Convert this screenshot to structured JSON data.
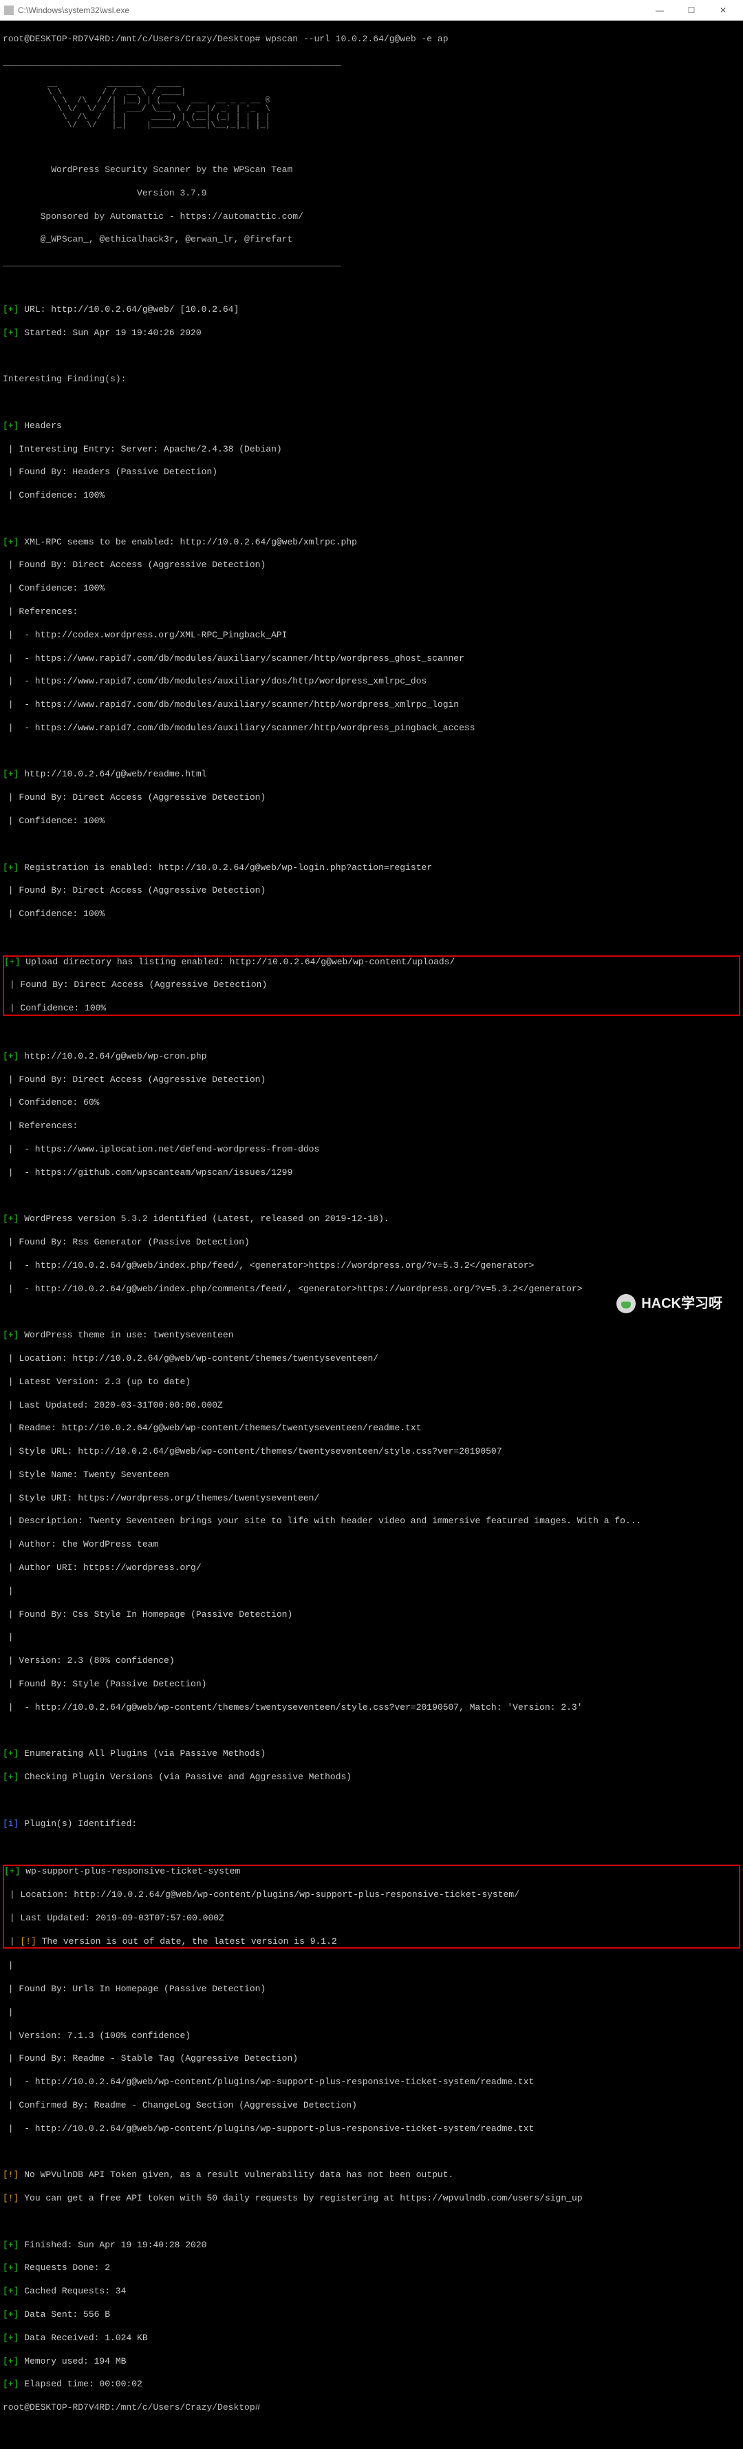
{
  "window": {
    "title": "C:\\Windows\\system32\\wsl.exe",
    "min": "—",
    "max": "☐",
    "close": "✕"
  },
  "prompt1": "root@DESKTOP-RD7V4RD:/mnt/c/Users/Crazy/Desktop# wpscan --url 10.0.2.64/g@web -e ap",
  "logo_art": "         __          _______   _____\n         \\ \\        / /  __ \\ / ____|\n          \\ \\  /\\  / /| |__) | (___   ___  __ _ _ __ ®\n           \\ \\/  \\/ / |  ___/ \\___ \\ / __|/ _` | '_  \\\n            \\  /\\  /  | |     ____) | (__| (_| | | | |\n             \\/  \\/   |_|    |_____/ \\___|\\__,_|_| |_|",
  "banner": {
    "l1": "         WordPress Security Scanner by the WPScan Team",
    "l2": "                         Version 3.7.9",
    "l3": "       Sponsored by Automattic - https://automattic.com/",
    "l4": "       @_WPScan_, @ethicalhack3r, @erwan_lr, @firefart"
  },
  "divtop": "_______________________________________________________________",
  "divbot": "_______________________________________________________________",
  "startinfo": {
    "url": "URL: http://10.0.2.64/g@web/ [10.0.2.64]",
    "started": "Started: Sun Apr 19 19:40:26 2020"
  },
  "heading_findings": "Interesting Finding(s):",
  "headers": {
    "title": "Headers",
    "l1": "Interesting Entry: Server: Apache/2.4.38 (Debian)",
    "l2": "Found By: Headers (Passive Detection)",
    "l3": "Confidence: 100%"
  },
  "xmlrpc": {
    "title": "XML-RPC seems to be enabled: http://10.0.2.64/g@web/xmlrpc.php",
    "l1": "Found By: Direct Access (Aggressive Detection)",
    "l2": "Confidence: 100%",
    "l3": "References:",
    "r1": " - http://codex.wordpress.org/XML-RPC_Pingback_API",
    "r2": " - https://www.rapid7.com/db/modules/auxiliary/scanner/http/wordpress_ghost_scanner",
    "r3": " - https://www.rapid7.com/db/modules/auxiliary/dos/http/wordpress_xmlrpc_dos",
    "r4": " - https://www.rapid7.com/db/modules/auxiliary/scanner/http/wordpress_xmlrpc_login",
    "r5": " - https://www.rapid7.com/db/modules/auxiliary/scanner/http/wordpress_pingback_access"
  },
  "readme": {
    "title": "http://10.0.2.64/g@web/readme.html",
    "l1": "Found By: Direct Access (Aggressive Detection)",
    "l2": "Confidence: 100%"
  },
  "register": {
    "title": "Registration is enabled: http://10.0.2.64/g@web/wp-login.php?action=register",
    "l1": "Found By: Direct Access (Aggressive Detection)",
    "l2": "Confidence: 100%"
  },
  "uploads": {
    "title": "Upload directory has listing enabled: http://10.0.2.64/g@web/wp-content/uploads/",
    "l1": "Found By: Direct Access (Aggressive Detection)",
    "l2": "Confidence: 100%"
  },
  "wpcron": {
    "title": "http://10.0.2.64/g@web/wp-cron.php",
    "l1": "Found By: Direct Access (Aggressive Detection)",
    "l2": "Confidence: 60%",
    "l3": "References:",
    "r1": " - https://www.iplocation.net/defend-wordpress-from-ddos",
    "r2": " - https://github.com/wpscanteam/wpscan/issues/1299"
  },
  "wpver": {
    "title": "WordPress version 5.3.2 identified (Latest, released on 2019-12-18).",
    "l1": "Found By: Rss Generator (Passive Detection)",
    "l2": " - http://10.0.2.64/g@web/index.php/feed/, <generator>https://wordpress.org/?v=5.3.2</generator>",
    "l3": " - http://10.0.2.64/g@web/index.php/comments/feed/, <generator>https://wordpress.org/?v=5.3.2</generator>"
  },
  "theme": {
    "title": "WordPress theme in use: twentyseventeen",
    "loc": "Location: http://10.0.2.64/g@web/wp-content/themes/twentyseventeen/",
    "lv": "Latest Version: 2.3 (up to date)",
    "lu": "Last Updated: 2020-03-31T00:00:00.000Z",
    "rd": "Readme: http://10.0.2.64/g@web/wp-content/themes/twentyseventeen/readme.txt",
    "surl": "Style URL: http://10.0.2.64/g@web/wp-content/themes/twentyseventeen/style.css?ver=20190507",
    "sname": "Style Name: Twenty Seventeen",
    "suri": "Style URI: https://wordpress.org/themes/twentyseventeen/",
    "desc": "Description: Twenty Seventeen brings your site to life with header video and immersive featured images. With a fo...",
    "auth": "Author: the WordPress team",
    "authuri": "Author URI: https://wordpress.org/",
    "fb": "Found By: Css Style In Homepage (Passive Detection)",
    "ver": "Version: 2.3 (80% confidence)",
    "fb2": "Found By: Style (Passive Detection)",
    "fb3": " - http://10.0.2.64/g@web/wp-content/themes/twentyseventeen/style.css?ver=20190507, Match: 'Version: 2.3'"
  },
  "enum": {
    "l1": "Enumerating All Plugins (via Passive Methods)",
    "l2": "Checking Plugin Versions (via Passive and Aggressive Methods)"
  },
  "plugin_head": "Plugin(s) Identified:",
  "plugin": {
    "title": "wp-support-plus-responsive-ticket-system",
    "loc": "Location: http://10.0.2.64/g@web/wp-content/plugins/wp-support-plus-responsive-ticket-system/",
    "lu": "Last Updated: 2019-09-03T07:57:00.000Z",
    "warn": "The version is out of date, the latest version is 9.1.2",
    "fb": "Found By: Urls In Homepage (Passive Detection)",
    "ver": "Version: 7.1.3 (100% confidence)",
    "fb2": "Found By: Readme - Stable Tag (Aggressive Detection)",
    "fb3": " - http://10.0.2.64/g@web/wp-content/plugins/wp-support-plus-responsive-ticket-system/readme.txt",
    "cb": "Confirmed By: Readme - ChangeLog Section (Aggressive Detection)",
    "cb2": " - http://10.0.2.64/g@web/wp-content/plugins/wp-support-plus-responsive-ticket-system/readme.txt"
  },
  "warn": {
    "l1": "No WPVulnDB API Token given, as a result vulnerability data has not been output.",
    "l2": "You can get a free API token with 50 daily requests by registering at https://wpvulndb.com/users/sign_up"
  },
  "stats": {
    "fin": "Finished: Sun Apr 19 19:40:28 2020",
    "req": "Requests Done: 2",
    "cache": "Cached Requests: 34",
    "sent": "Data Sent: 556 B",
    "recv": "Data Received: 1.024 KB",
    "mem": "Memory used: 194 MB",
    "time": "Elapsed time: 00:00:02"
  },
  "prompt2": "root@DESKTOP-RD7V4RD:/mnt/c/Users/Crazy/Desktop#",
  "watermark": "HACK学习呀"
}
